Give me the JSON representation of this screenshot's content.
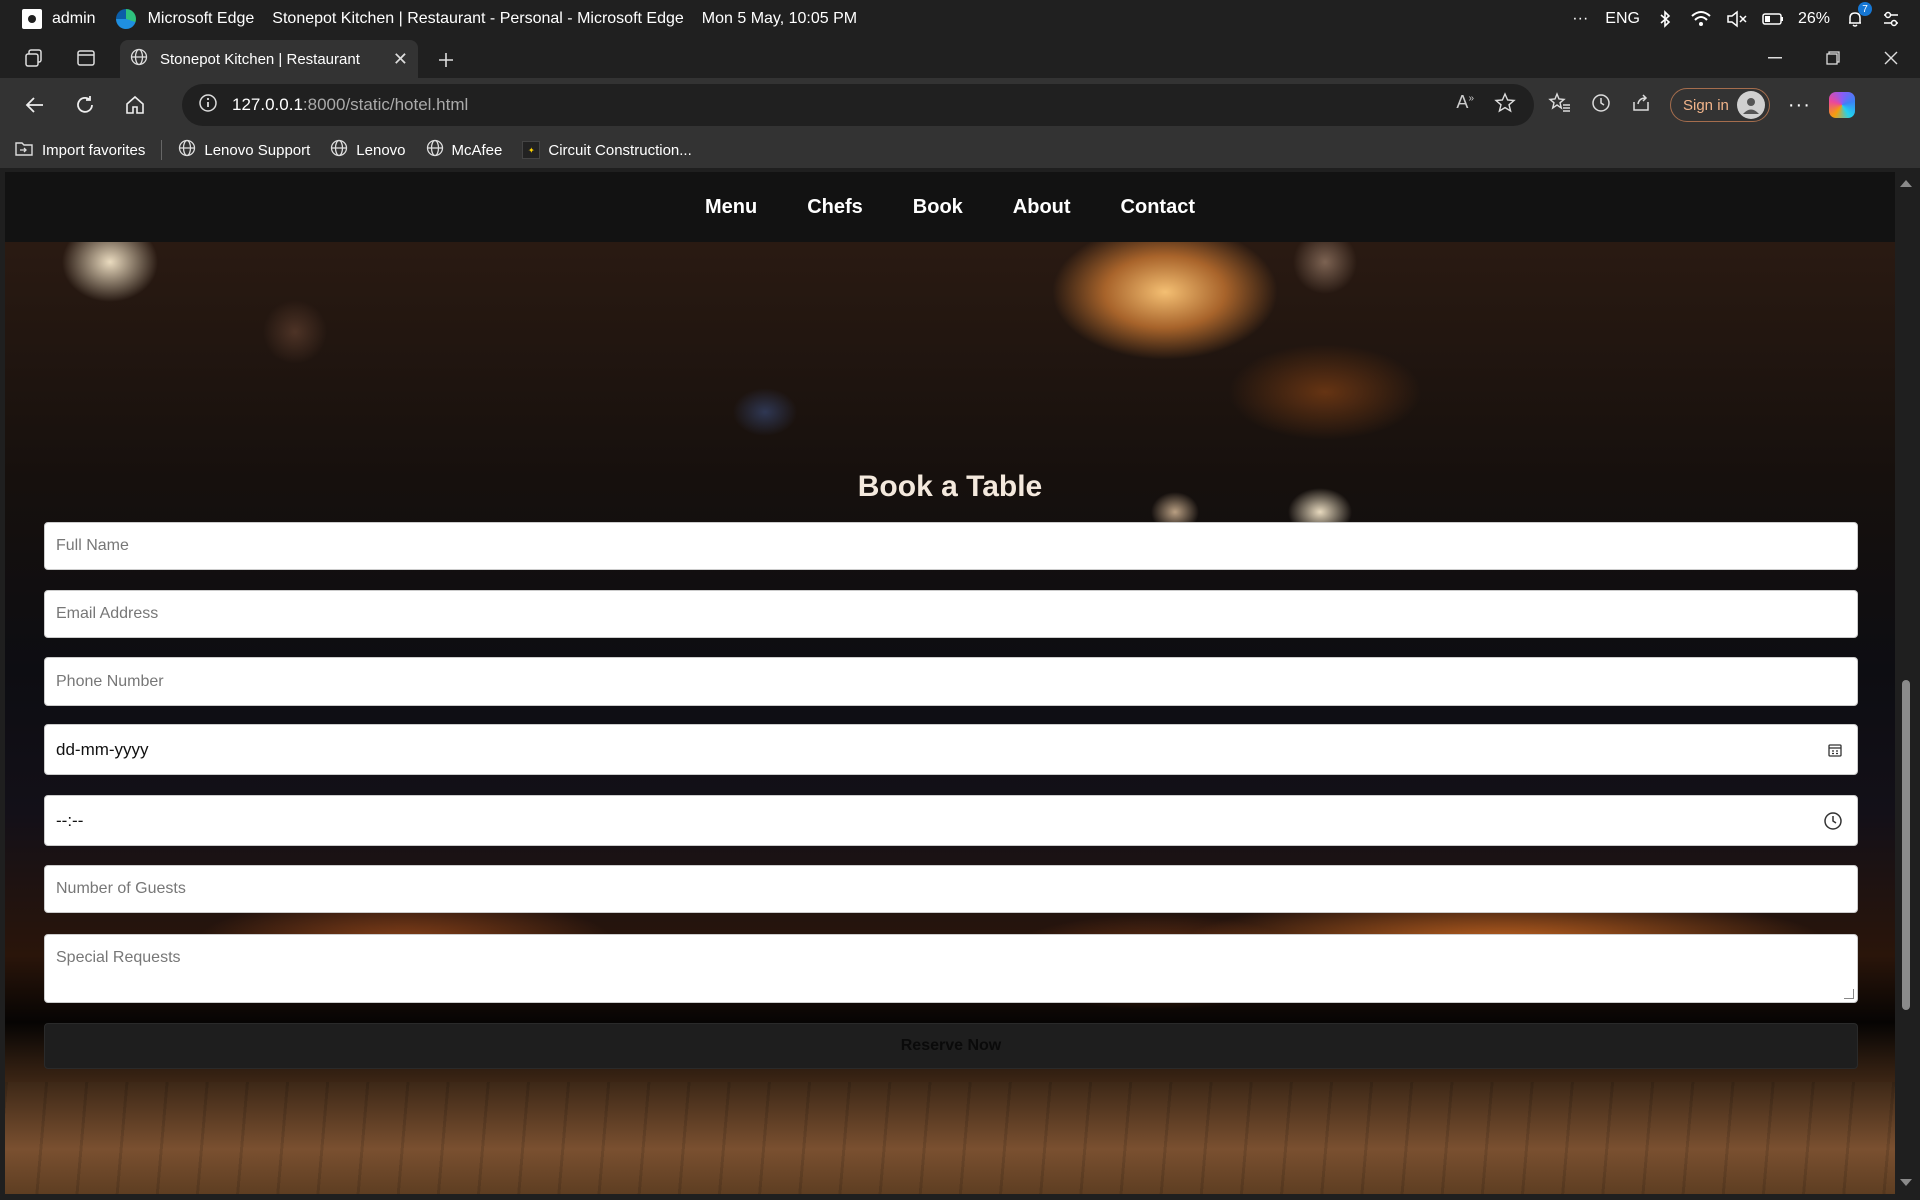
{
  "os": {
    "user": "admin",
    "app_name": "Microsoft Edge",
    "window_title": "Stonepot Kitchen | Restaurant - Personal - Microsoft Edge",
    "datetime": "Mon 5 May, 10:05 PM",
    "language": "ENG",
    "battery": "26%",
    "notification_count": "7"
  },
  "tab": {
    "title": "Stonepot Kitchen | Restaurant"
  },
  "address": {
    "host": "127.0.0.1",
    "path": ":8000/static/hotel.html"
  },
  "toolbar": {
    "sign_in": "Sign in"
  },
  "favorites": [
    {
      "label": "Import favorites"
    },
    {
      "label": "Lenovo Support"
    },
    {
      "label": "Lenovo"
    },
    {
      "label": "McAfee"
    },
    {
      "label": "Circuit Construction..."
    }
  ],
  "site_nav": [
    "Menu",
    "Chefs",
    "Book",
    "About",
    "Contact"
  ],
  "booking": {
    "title": "Book a Table",
    "full_name_placeholder": "Full Name",
    "email_placeholder": "Email Address",
    "phone_placeholder": "Phone Number",
    "date_value": "dd-mm-yyyy",
    "time_value": "--:--",
    "guests_placeholder": "Number of Guests",
    "requests_placeholder": "Special Requests",
    "submit_label": "Reserve Now"
  }
}
